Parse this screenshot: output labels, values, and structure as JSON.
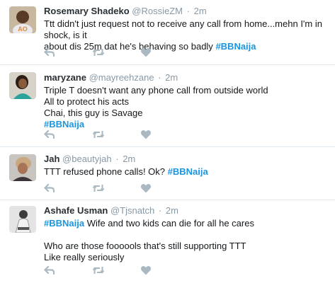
{
  "tweets": [
    {
      "name": "Rosemary Shadeko",
      "handle": "@RossieZM",
      "separator": "·",
      "time": "2m",
      "lines": [
        [
          {
            "t": "Ttt didn't just request not to receive any call from home...mehn I'm in shock, is it"
          }
        ],
        [
          {
            "t": "about dis 25m dat he's behaving so badly "
          },
          {
            "t": "#BBNaija",
            "tag": true
          }
        ]
      ]
    },
    {
      "name": "maryzane",
      "handle": "@mayreehzane",
      "separator": "·",
      "time": "2m",
      "lines": [
        [
          {
            "t": "Triple T doesn't want any phone call from outside world"
          }
        ],
        [
          {
            "t": "All to protect his acts"
          }
        ],
        [
          {
            "t": "Chai, this guy is Savage"
          }
        ],
        [
          {
            "t": "#BBNaija",
            "tag": true
          }
        ]
      ]
    },
    {
      "name": "Jah",
      "handle": "@beautyjah",
      "separator": "·",
      "time": "2m",
      "lines": [
        [
          {
            "t": "TTT refused phone calls! Ok? "
          },
          {
            "t": "#BBNaija",
            "tag": true
          }
        ]
      ]
    },
    {
      "name": "Ashafe Usman",
      "handle": "@Tjsnatch",
      "separator": "·",
      "time": "2m",
      "lines": [
        [
          {
            "t": "#BBNaija",
            "tag": true
          },
          {
            "t": " Wife and two kids can die for all he cares"
          }
        ],
        [],
        [
          {
            "t": "Who are those foooools that's still supporting TTT"
          }
        ],
        [
          {
            "t": "Like really seriously"
          }
        ]
      ]
    }
  ],
  "icons": {
    "reply": "reply-icon",
    "retweet": "retweet-icon",
    "like": "heart-icon"
  },
  "colors": {
    "hashtag": "#1b95e0",
    "muted": "#8899a6",
    "icon": "#aab8c2",
    "divider": "#e1e8ed"
  }
}
